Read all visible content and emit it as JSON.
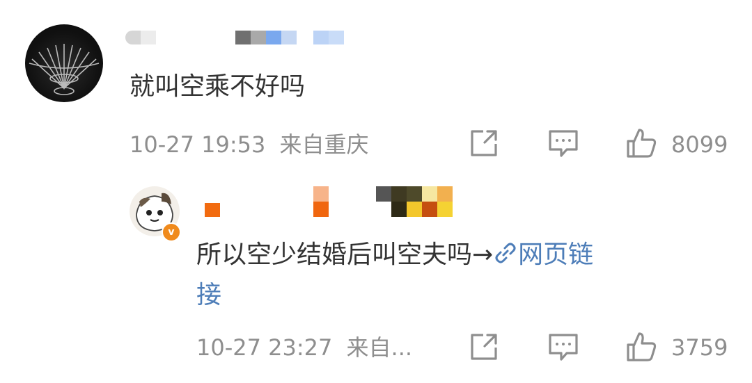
{
  "comments": [
    {
      "text": "就叫空乘不好吗",
      "time": "10-27 19:53",
      "location": "来自重庆",
      "likes": "8099"
    },
    {
      "text_line1": "所以空少结婚后叫空夫吗→",
      "link_text_part1": "网页链",
      "link_text_part2": "接",
      "time": "10-27 23:27",
      "location": "来自...",
      "likes": "3759",
      "verified_badge": "v"
    }
  ],
  "icons": [
    "share-icon",
    "comment-icon",
    "like-icon",
    "link-icon"
  ],
  "colors": {
    "text": "#333333",
    "meta": "#8e8e8e",
    "link": "#4d7db8",
    "badge": "#f08a1c"
  }
}
